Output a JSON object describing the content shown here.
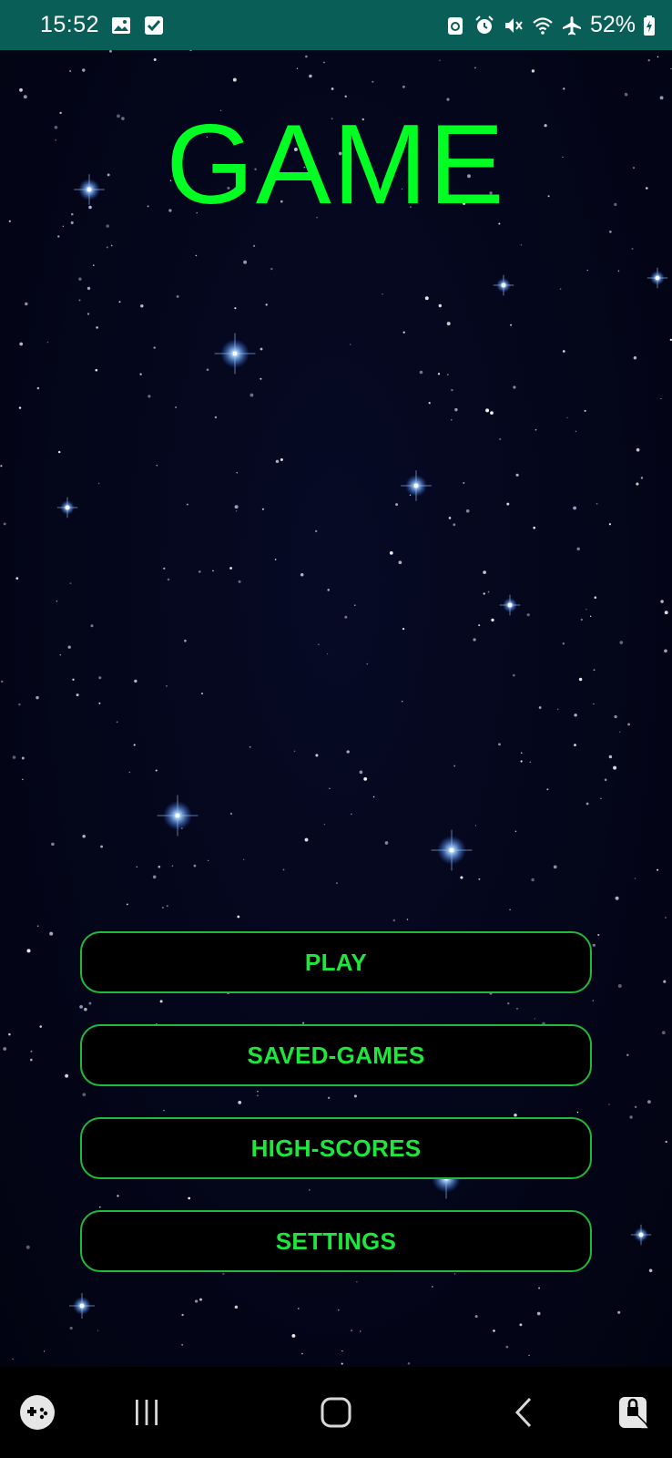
{
  "status_bar": {
    "time": "15:52",
    "battery": "52%",
    "left_icons": [
      "gallery-icon",
      "checkbox-icon"
    ],
    "right_icons": [
      "recycle-icon",
      "alarm-icon",
      "mute-icon",
      "wifi-icon",
      "airplane-icon",
      "battery-icon"
    ]
  },
  "game": {
    "title": "GAME",
    "title_color": "#00ff22",
    "button_border_color": "#21b93a",
    "button_text_color": "#1ee63c"
  },
  "menu": {
    "buttons": [
      {
        "label": "PLAY"
      },
      {
        "label": "SAVED-GAMES"
      },
      {
        "label": "HIGH-SCORES"
      },
      {
        "label": "SETTINGS"
      }
    ]
  },
  "nav_bar": {
    "icons": [
      "game-launcher-icon",
      "recent-apps-icon",
      "home-icon",
      "back-icon",
      "screen-lock-icon"
    ]
  }
}
